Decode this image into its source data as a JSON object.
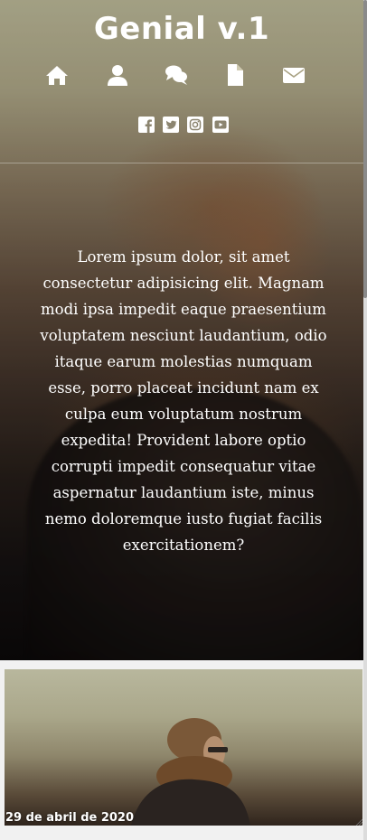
{
  "site": {
    "title": "Genial v.1"
  },
  "nav": {
    "items": [
      {
        "name": "home",
        "icon": "home-icon"
      },
      {
        "name": "profile",
        "icon": "user-icon"
      },
      {
        "name": "chat",
        "icon": "comments-icon"
      },
      {
        "name": "document",
        "icon": "file-icon"
      },
      {
        "name": "mail",
        "icon": "envelope-icon"
      }
    ]
  },
  "social": {
    "items": [
      {
        "name": "facebook",
        "icon": "facebook-icon"
      },
      {
        "name": "twitter",
        "icon": "twitter-icon"
      },
      {
        "name": "instagram",
        "icon": "instagram-icon"
      },
      {
        "name": "youtube",
        "icon": "youtube-icon"
      }
    ]
  },
  "hero": {
    "text": "Lorem ipsum dolor, sit amet consectetur adipisicing elit. Magnam modi ipsa impedit eaque praesentium voluptatem nesciunt laudantium, odio itaque earum molestias numquam esse, porro placeat incidunt nam ex culpa eum voluptatum nostrum expedita! Provident labore optio corrupti impedit consequatur vitae aspernatur laudantium iste, minus nemo doloremque iusto fugiat facilis exercitationem?"
  },
  "card": {
    "date": "29 de abril de 2020"
  },
  "colors": {
    "text": "#ffffff",
    "page_bg": "#f1f1f1"
  }
}
